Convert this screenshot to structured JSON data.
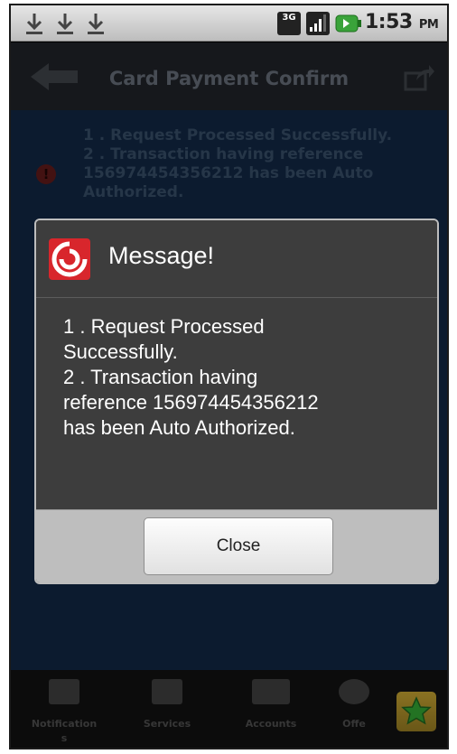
{
  "status_bar": {
    "time": "1:53",
    "ampm": "PM",
    "network": "3G",
    "icons": [
      "download-icon",
      "download-icon",
      "download-icon",
      "3g-icon",
      "signal-icon",
      "battery-icon"
    ]
  },
  "title_bar": {
    "title": "Card Payment Confirm",
    "icons": [
      "back-arrow-icon",
      "share-icon"
    ]
  },
  "background_message": {
    "icon": "error-icon",
    "icon_glyph": "!",
    "text": "1 . Request Processed Successfully.\n2 . Transaction having reference 156974454356212 has been Auto Authorized."
  },
  "dialog": {
    "title": "Message!",
    "icon": "app-logo-icon",
    "message": "1 . Request Processed\nSuccessfully.\n2 . Transaction having\nreference 156974454356212\nhas been Auto Authorized.",
    "close_label": "Close"
  },
  "tab_bar": {
    "tabs": [
      {
        "label": "Notification\ns",
        "icon": "notifications-icon"
      },
      {
        "label": "Services",
        "icon": "services-icon"
      },
      {
        "label": "Accounts",
        "icon": "accounts-icon"
      },
      {
        "label": "Offe",
        "icon": "offers-icon"
      }
    ],
    "favorite_icon": "star-icon"
  },
  "colors": {
    "brand_red": "#d8262c",
    "star_green": "#2f9a2f",
    "content_blue": "#10253f"
  }
}
